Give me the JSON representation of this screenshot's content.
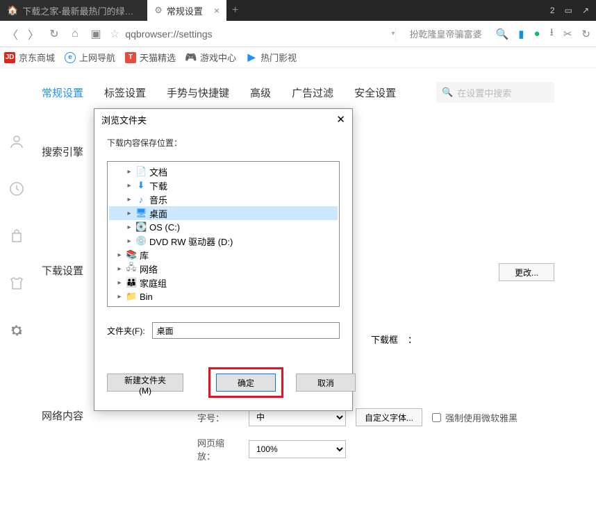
{
  "titlebar": {
    "tab1": "下载之家-最新最热门的绿色软件下载",
    "tab2": "常规设置",
    "count": "2"
  },
  "toolbar": {
    "url": "qqbrowser://settings",
    "suggestion": "扮乾隆皇帝骗富婆"
  },
  "bookmarks": {
    "jd": "京东商城",
    "e": "上网导航",
    "t": "天猫精选",
    "g": "游戏中心",
    "p": "热门影视"
  },
  "nav": {
    "general": "常规设置",
    "tabs": "标签设置",
    "gesture": "手势与快捷键",
    "advanced": "高级",
    "adblock": "广告过滤",
    "security": "安全设置",
    "search_placeholder": "在设置中搜索"
  },
  "sections": {
    "search": {
      "title": "搜索引擎"
    },
    "download": {
      "title": "下载设置",
      "change": "更改...",
      "popup": "下载框"
    },
    "network": {
      "title": "网络内容",
      "fontsize": "字号：",
      "zoom": "网页缩放：",
      "fontsize_val": "中",
      "zoom_val": "100%",
      "custom_font": "自定义字体...",
      "force_yahei": "强制使用微软雅黑"
    }
  },
  "dialog": {
    "title": "浏览文件夹",
    "label": "下载内容保存位置：",
    "tree": [
      {
        "lvl": 2,
        "caret": "▸",
        "ico": "📄",
        "text": "文档",
        "color": "#5b9bd5"
      },
      {
        "lvl": 2,
        "caret": "▸",
        "ico": "⬇",
        "text": "下载",
        "color": "#1e90ff"
      },
      {
        "lvl": 2,
        "caret": "▸",
        "ico": "♪",
        "text": "音乐",
        "color": "#1e90ff"
      },
      {
        "lvl": 2,
        "caret": "▸",
        "ico": "🖥",
        "text": "桌面",
        "sel": true,
        "color": "#1e90ff"
      },
      {
        "lvl": 2,
        "caret": "▸",
        "ico": "💽",
        "text": "OS (C:)",
        "color": "#888"
      },
      {
        "lvl": 2,
        "caret": "▸",
        "ico": "💿",
        "text": "DVD RW 驱动器 (D:)",
        "color": "#888"
      },
      {
        "lvl": 1,
        "caret": "▸",
        "ico": "📚",
        "text": "库",
        "color": "#f0a030"
      },
      {
        "lvl": 1,
        "caret": "▸",
        "ico": "🖧",
        "text": "网络",
        "color": "#888"
      },
      {
        "lvl": 1,
        "caret": "▸",
        "ico": "👪",
        "text": "家庭组",
        "color": "#888"
      },
      {
        "lvl": 1,
        "caret": "▸",
        "ico": "📁",
        "text": "Bin",
        "color": "#f0c040"
      },
      {
        "lvl": 1,
        "caret": "",
        "ico": "",
        "text": "",
        "color": ""
      }
    ],
    "folder_label": "文件夹(F):",
    "folder_value": "桌面",
    "newfolder": "新建文件夹(M)",
    "ok": "确定",
    "cancel": "取消"
  }
}
